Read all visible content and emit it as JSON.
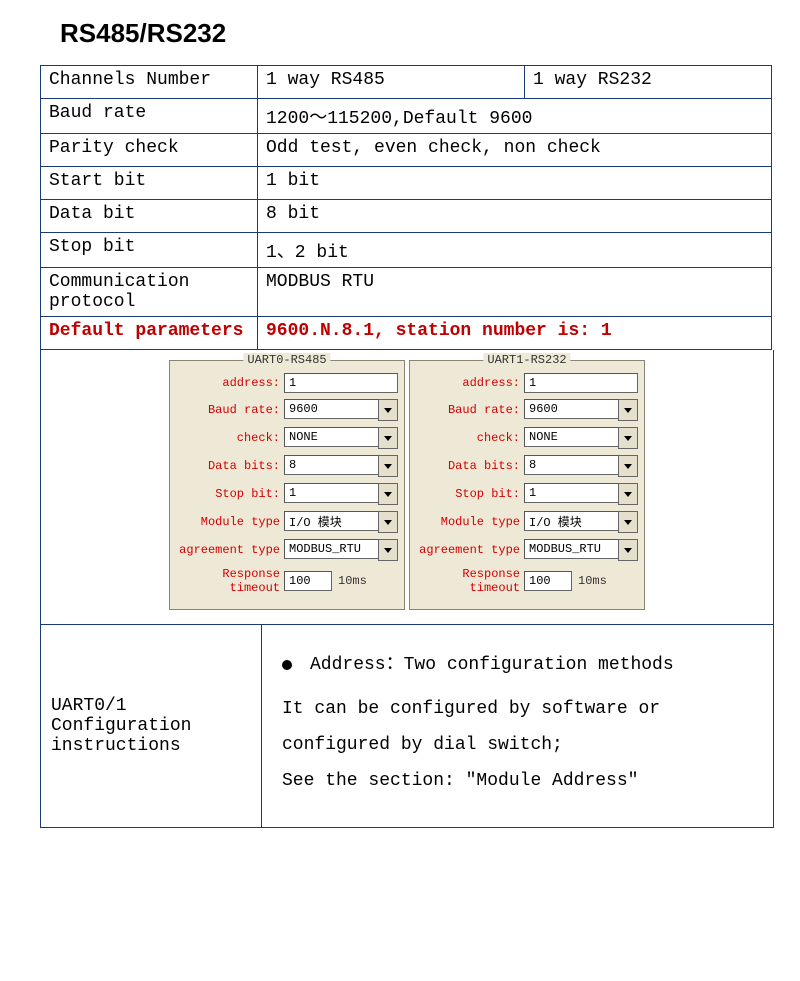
{
  "title": "RS485/RS232",
  "spec": {
    "channels_label": "Channels Number",
    "channels_v1": "1 way RS485",
    "channels_v2": "1 way RS232",
    "baud_label": "Baud rate",
    "baud_value": "1200～115200,Default 9600",
    "parity_label": "Parity check",
    "parity_value": "Odd test, even check, non check",
    "start_label": "Start bit",
    "start_value": "1 bit",
    "data_label": "Data bit",
    "data_value": "8 bit",
    "stop_label": "Stop bit",
    "stop_value": "1、2 bit",
    "proto_label": "Communication protocol",
    "proto_value": "MODBUS RTU",
    "default_label": "Default parameters",
    "default_value": "9600.N.8.1, station number is: 1"
  },
  "uart_labels": {
    "address": "address:",
    "baud": "Baud rate:",
    "check": "check:",
    "databits": "Data bits:",
    "stopbit": "Stop bit:",
    "module": "Module type",
    "agreement": "agreement type",
    "timeout": "Response timeout",
    "unit": "10ms"
  },
  "uart0": {
    "title": "UART0-RS485",
    "address": "1",
    "baud": "9600",
    "check": "NONE",
    "databits": "8",
    "stopbit": "1",
    "module": "I/O 模块",
    "agreement": "MODBUS_RTU",
    "timeout": "100"
  },
  "uart1": {
    "title": "UART1-RS232",
    "address": "1",
    "baud": "9600",
    "check": "NONE",
    "databits": "8",
    "stopbit": "1",
    "module": "I/O 模块",
    "agreement": "MODBUS_RTU",
    "timeout": "100"
  },
  "instructions": {
    "left": "UART0/1 Configuration instructions",
    "bullet": "Address：Two configuration methods",
    "line1": "It can be configured by software or configured by dial switch;",
    "line2": "See the section: \"Module Address\""
  }
}
